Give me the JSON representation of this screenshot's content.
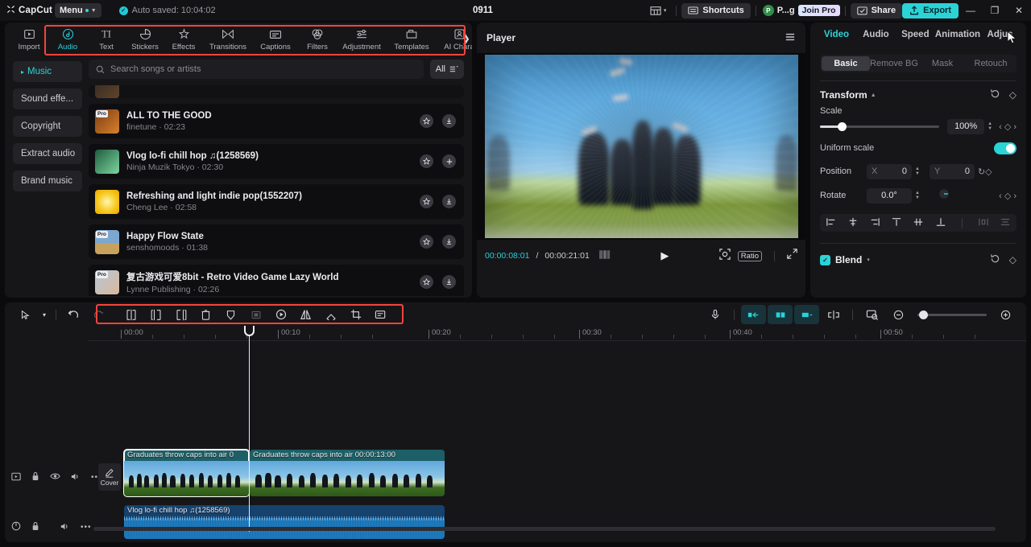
{
  "titlebar": {
    "brand": "CapCut",
    "menu_label": "Menu",
    "autosave": "Auto saved: 10:04:02",
    "project_name": "0911",
    "shortcuts_label": "Shortcuts",
    "user_name": "P...g",
    "user_initial": "P",
    "join_pro_label": "Join Pro",
    "share_label": "Share",
    "export_label": "Export",
    "minimize": "—",
    "maximize": "❐",
    "close": "✕"
  },
  "function_tabs": [
    {
      "label": "Import",
      "icon": "import-icon",
      "active": false
    },
    {
      "label": "Audio",
      "icon": "audio-note-icon",
      "active": true
    },
    {
      "label": "Text",
      "icon": "text-icon",
      "active": false
    },
    {
      "label": "Stickers",
      "icon": "sticker-icon",
      "active": false
    },
    {
      "label": "Effects",
      "icon": "effects-icon",
      "active": false
    },
    {
      "label": "Transitions",
      "icon": "transitions-icon",
      "active": false
    },
    {
      "label": "Captions",
      "icon": "captions-icon",
      "active": false
    },
    {
      "label": "Filters",
      "icon": "filters-icon",
      "active": false
    },
    {
      "label": "Adjustment",
      "icon": "adjustment-icon",
      "active": false
    },
    {
      "label": "Templates",
      "icon": "templates-icon",
      "active": false
    },
    {
      "label": "AI Chara",
      "icon": "ai-character-icon",
      "active": false
    }
  ],
  "categories": [
    {
      "label": "Music",
      "active": true
    },
    {
      "label": "Sound effe...",
      "active": false
    },
    {
      "label": "Copyright",
      "active": false
    },
    {
      "label": "Extract audio",
      "active": false
    },
    {
      "label": "Brand music",
      "active": false
    }
  ],
  "search": {
    "placeholder": "Search songs or artists",
    "filter_label": "All"
  },
  "songs": [
    {
      "title": "",
      "artist": "",
      "duration": "",
      "pro": true,
      "action": "download",
      "partial": true
    },
    {
      "title": "ALL TO THE GOOD",
      "artist": "finetune",
      "duration": "02:23",
      "pro": true,
      "action": "download",
      "partial": false
    },
    {
      "title": "Vlog  lo-fi chill hop ♫(1258569)",
      "artist": "Ninja Muzik Tokyo",
      "duration": "02:30",
      "pro": false,
      "action": "add",
      "partial": false
    },
    {
      "title": "Refreshing and light indie pop(1552207)",
      "artist": "Cheng Lee",
      "duration": "02:58",
      "pro": false,
      "action": "download",
      "partial": false
    },
    {
      "title": "Happy Flow State",
      "artist": "senshomoods",
      "duration": "01:38",
      "pro": true,
      "action": "download",
      "partial": false
    },
    {
      "title": "复古游戏可爱8bit - Retro Video Game Lazy World",
      "artist": "Lynne Publishing",
      "duration": "02:26",
      "pro": true,
      "action": "download",
      "partial": false
    }
  ],
  "player": {
    "title": "Player",
    "current_time": "00:00:08:01",
    "total_time": "00:00:21:01",
    "separator": "/",
    "ratio_label": "Ratio"
  },
  "attributes": {
    "tabs": [
      {
        "label": "Video",
        "active": true
      },
      {
        "label": "Audio",
        "active": false
      },
      {
        "label": "Speed",
        "active": false
      },
      {
        "label": "Animation",
        "active": false
      },
      {
        "label": "Adjus",
        "active": false
      }
    ],
    "sub_tabs": [
      {
        "label": "Basic",
        "active": true
      },
      {
        "label": "Remove BG",
        "active": false
      },
      {
        "label": "Mask",
        "active": false
      },
      {
        "label": "Retouch",
        "active": false
      }
    ],
    "transform_title": "Transform",
    "scale_label": "Scale",
    "scale_value": "100%",
    "uniform_scale_label": "Uniform scale",
    "uniform_scale_on": true,
    "position_label": "Position",
    "position_x_axis": "X",
    "position_x": "0",
    "position_y_axis": "Y",
    "position_y": "0",
    "rotate_label": "Rotate",
    "rotate_value": "0.0°",
    "blend_label": "Blend",
    "blend_checked": true
  },
  "timeline": {
    "tool_icons": [
      "select-cursor-icon",
      "undo-icon",
      "redo-icon",
      "split-icon",
      "trim-left-icon",
      "trim-right-icon",
      "delete-icon",
      "freeze-icon",
      "picture-in-picture-icon",
      "speed-icon",
      "mirror-icon",
      "rotate-icon",
      "crop-icon",
      "caption-edit-icon"
    ],
    "right_icons": [
      "microphone-icon",
      "auto-cut-left-icon",
      "auto-cut-center-icon",
      "auto-cut-right-icon",
      "split-marker-icon",
      "thumbnail-preview-icon",
      "zoom-out-icon",
      "zoom-in-icon"
    ],
    "ruler_labels": [
      "00:00",
      "00:10",
      "00:20",
      "00:30",
      "00:40",
      "00:50"
    ],
    "video_track": {
      "cover_label": "Cover",
      "controls": [
        "video-track-icon",
        "lock-icon",
        "eye-icon",
        "volume-icon",
        "more-icon"
      ],
      "clips": [
        {
          "label": "Graduates throw caps into air  0",
          "selected": true
        },
        {
          "label": "Graduates throw caps into air  00:00:13:00",
          "selected": false
        }
      ]
    },
    "audio_track": {
      "controls": [
        "audio-track-icon",
        "lock-icon",
        "volume-icon",
        "more-icon"
      ],
      "clips": [
        {
          "label": "Vlog  lo-fi chill hop ♫(1258569)"
        }
      ]
    }
  },
  "colors": {
    "accent": "#2ad3d6",
    "highlight_box": "#f4443c",
    "panel_bg": "#161619",
    "app_bg": "#0b0b0d",
    "video_clip": "#1d5f66",
    "audio_clip": "#16426e"
  }
}
